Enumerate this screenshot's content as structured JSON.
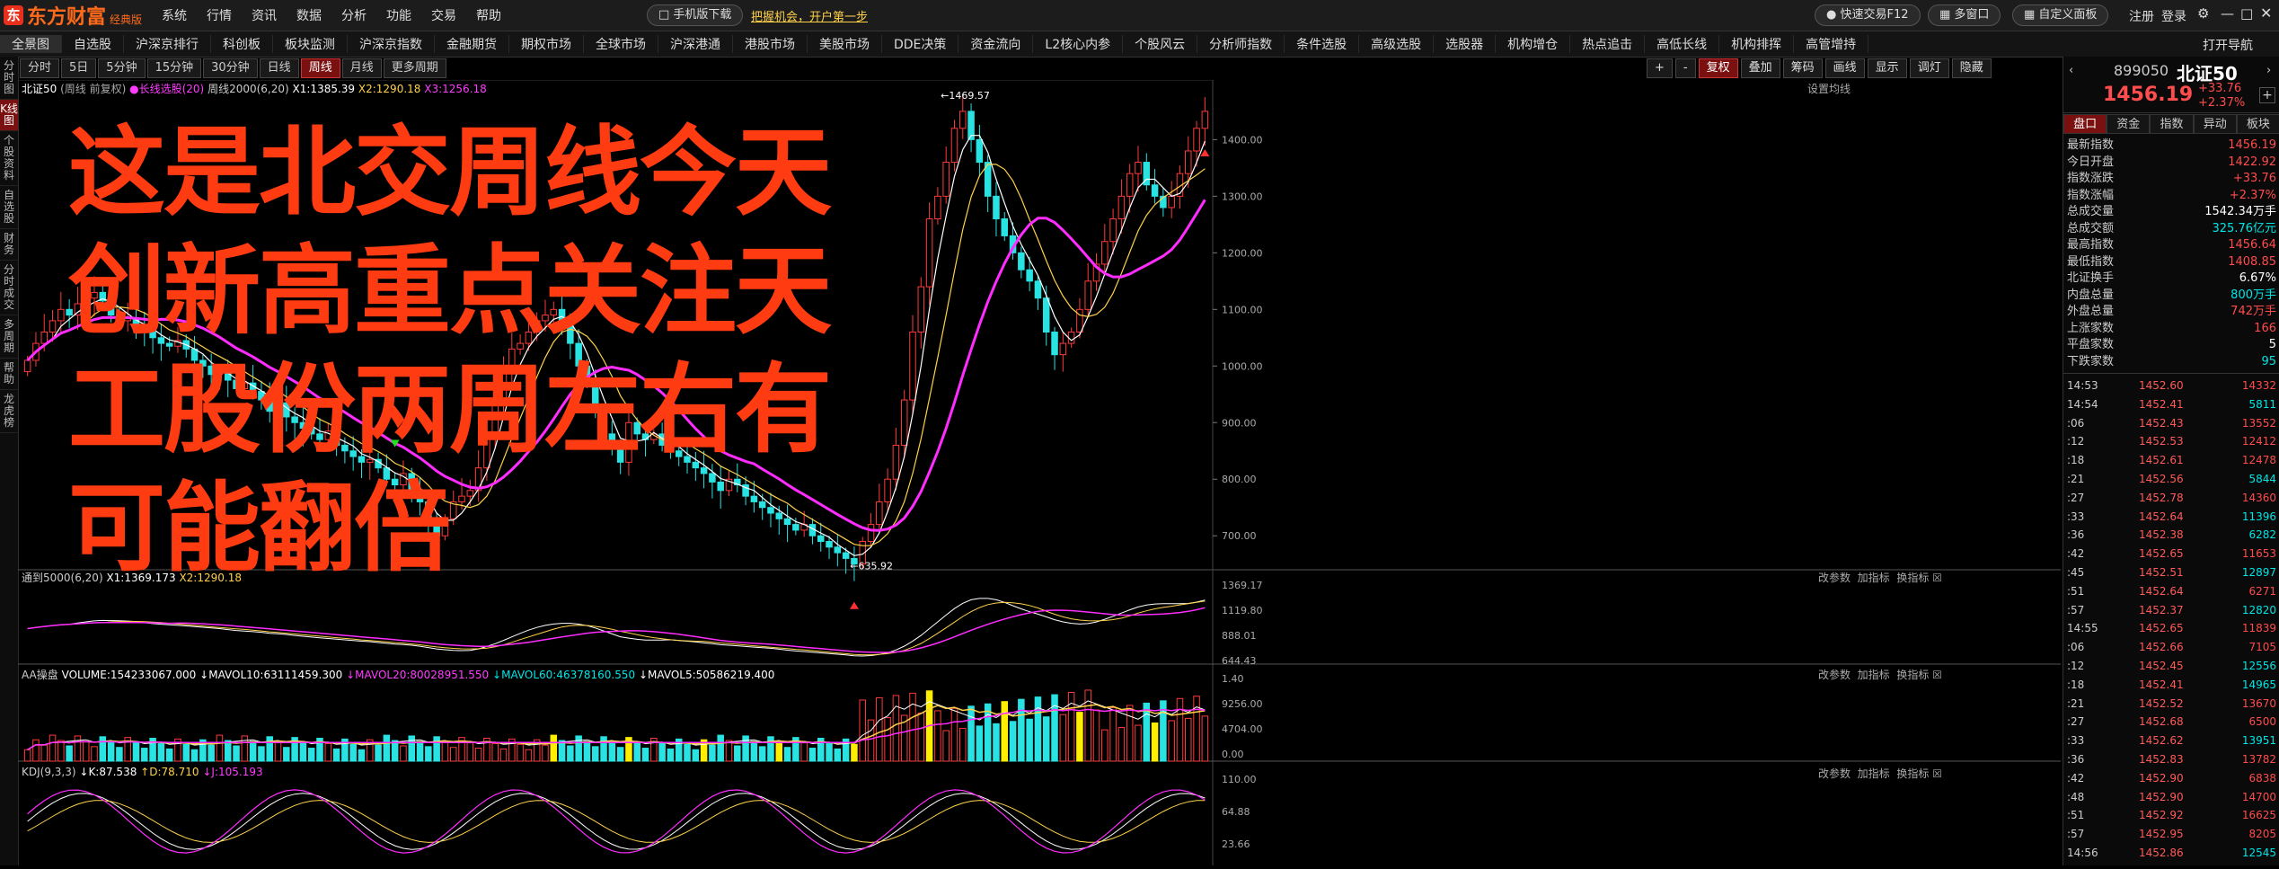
{
  "app": {
    "logo": "东方财富",
    "logo_sub": "经典版",
    "menu": [
      "系统",
      "行情",
      "资讯",
      "数据",
      "分析",
      "功能",
      "交易",
      "帮助"
    ],
    "download": "手机版下载",
    "promo": "把握机会，开户第一步",
    "quick_trade": "快速交易F12",
    "multi_window": "多窗口",
    "custom_panel": "自定义面板",
    "login": "注册",
    "logout": "登录"
  },
  "nav": [
    "全景图",
    "自选股",
    "沪深京排行",
    "科创板",
    "板块监测",
    "沪深京指数",
    "金融期货",
    "期权市场",
    "全球市场",
    "沪深港通",
    "港股市场",
    "美股市场",
    "DDE决策",
    "资金流向",
    "L2核心内参",
    "个股风云",
    "分析师指数",
    "条件选股",
    "高级选股",
    "选股器",
    "机构增仓",
    "热点追击",
    "高低长线",
    "机构排挥",
    "高管增持"
  ],
  "nav_right": "打开导航",
  "periods": [
    "分时",
    "5日",
    "5分钟",
    "15分钟",
    "30分钟",
    "日线",
    "周线",
    "月线",
    "更多周期"
  ],
  "active_period": "周线",
  "tools_right": [
    "+",
    "-",
    "复权",
    "叠加",
    "筹码",
    "画线",
    "显示",
    "调灯",
    "隐藏"
  ],
  "left_strip": [
    "分时图",
    "K线图",
    "个股资料",
    "自选股",
    "财务",
    "分时成交",
    "多周期",
    "帮助",
    "龙虎榜"
  ],
  "chart_header": {
    "name": "北证50",
    "mode": "(周线 前复权)",
    "ma_label": "长线选股(20)",
    "ma2_label": "周线2000(6,20)",
    "x1": "X1:1385.39",
    "x2": "X2:1290.18",
    "x3": "X3:1256.18",
    "setting": "设置均线"
  },
  "overlay_text": [
    "这是北交周线今天",
    "创新高重点关注天",
    "工股份两周左右有",
    "可能翻倍"
  ],
  "chart_data": {
    "type": "candlestick",
    "y_ticks": [
      "1400.00",
      "1300.00",
      "1200.00",
      "1100.00",
      "1000.00",
      "900.00",
      "800.00",
      "700.00"
    ],
    "ylim": [
      640,
      1480
    ],
    "annotations": [
      "1469.57",
      "635.92"
    ],
    "closes": [
      1010,
      1040,
      1060,
      1080,
      1100,
      1090,
      1110,
      1120,
      1130,
      1115,
      1090,
      1080,
      1085,
      1070,
      1060,
      1050,
      1040,
      1035,
      1045,
      1030,
      1010,
      1000,
      985,
      990,
      975,
      960,
      970,
      955,
      940,
      920,
      935,
      910,
      900,
      890,
      880,
      870,
      885,
      860,
      850,
      840,
      830,
      835,
      820,
      800,
      790,
      810,
      780,
      760,
      720,
      700,
      730,
      760,
      770,
      780,
      820,
      880,
      940,
      1000,
      1030,
      1040,
      1060,
      1080,
      1090,
      1100,
      1080,
      1040,
      1000,
      970,
      920,
      880,
      860,
      830,
      900,
      880,
      870,
      880,
      860,
      850,
      840,
      830,
      820,
      810,
      795,
      780,
      800,
      790,
      770,
      760,
      750,
      740,
      730,
      720,
      710,
      720,
      700,
      690,
      680,
      670,
      660,
      650,
      690,
      720,
      760,
      800,
      860,
      940,
      1060,
      1140,
      1260,
      1300,
      1360,
      1420,
      1450,
      1400,
      1360,
      1300,
      1260,
      1230,
      1200,
      1170,
      1150,
      1120,
      1060,
      1020,
      1040,
      1060,
      1100,
      1150,
      1180,
      1220,
      1260,
      1300,
      1340,
      1360,
      1320,
      1300,
      1280,
      1300,
      1340,
      1380,
      1420,
      1450
    ]
  },
  "sub1": {
    "label": "通到5000(6,20)",
    "x1": "X1:1369.173",
    "x2": "X2:1290.18",
    "y_ticks": [
      "1369.17",
      "1119.80",
      "888.01",
      "644.43"
    ],
    "btns": [
      "改参数",
      "加指标",
      "换指标"
    ]
  },
  "sub2": {
    "label": "AA操盘",
    "vol": "VOLUME:154233067.000",
    "mavol10": "MAVOL10:63111459.300",
    "mavol20": "MAVOL20:80028951.550",
    "mavol60": "MAVOL60:46378160.550",
    "mavol5": "MAVOL5:50586219.400",
    "y_ticks": [
      "1.40",
      "9256.00",
      "4704.00",
      "0.00"
    ],
    "btns": [
      "改参数",
      "加指标",
      "换指标"
    ]
  },
  "sub3": {
    "label": "KDJ(9,3,3)",
    "k": "K:87.538",
    "d": "D:78.710",
    "j": "J:105.193",
    "y_ticks": [
      "110.00",
      "64.88",
      "23.66"
    ],
    "btns": [
      "改参数",
      "加指标",
      "换指标"
    ]
  },
  "quote": {
    "code": "899050",
    "name": "北证50",
    "price": "1456.19",
    "change": "+33.76",
    "pct": "+2.37%",
    "tabs": [
      "盘口",
      "资金",
      "指数",
      "异动",
      "板块"
    ],
    "rows": [
      {
        "l": "最新指数",
        "r": "1456.19",
        "c": "red"
      },
      {
        "l": "今日开盘",
        "r": "1422.92",
        "c": "red"
      },
      {
        "l": "指数涨跌",
        "r": "+33.76",
        "c": "red"
      },
      {
        "l": "指数涨幅",
        "r": "+2.37%",
        "c": "red"
      },
      {
        "l": "总成交量",
        "r": "1542.34万手",
        "c": "white"
      },
      {
        "l": "总成交额",
        "r": "325.76亿元",
        "c": "green"
      },
      {
        "l": "最高指数",
        "r": "1456.64",
        "c": "red"
      },
      {
        "l": "最低指数",
        "r": "1408.85",
        "c": "red"
      },
      {
        "l": "北证换手",
        "r": "6.67%",
        "c": "white"
      },
      {
        "l": "内盘总量",
        "r": "800万手",
        "c": "green"
      },
      {
        "l": "外盘总量",
        "r": "742万手",
        "c": "red"
      },
      {
        "l": "上涨家数",
        "r": "166",
        "c": "red"
      },
      {
        "l": "平盘家数",
        "r": "5",
        "c": "white"
      },
      {
        "l": "下跌家数",
        "r": "95",
        "c": "green"
      }
    ],
    "ticks": [
      {
        "t": "14:53",
        "p": "1452.60",
        "v": "14332",
        "c": "red"
      },
      {
        "t": "14:54",
        "p": "1452.41",
        "v": "5811",
        "c": "green"
      },
      {
        "t": ":06",
        "p": "1452.43",
        "v": "13552",
        "c": "red"
      },
      {
        "t": ":12",
        "p": "1452.53",
        "v": "12412",
        "c": "red"
      },
      {
        "t": ":18",
        "p": "1452.61",
        "v": "12478",
        "c": "red"
      },
      {
        "t": ":21",
        "p": "1452.56",
        "v": "5844",
        "c": "green"
      },
      {
        "t": ":27",
        "p": "1452.78",
        "v": "14360",
        "c": "red"
      },
      {
        "t": ":33",
        "p": "1452.64",
        "v": "11396",
        "c": "green"
      },
      {
        "t": ":36",
        "p": "1452.38",
        "v": "6282",
        "c": "green"
      },
      {
        "t": ":42",
        "p": "1452.65",
        "v": "11653",
        "c": "red"
      },
      {
        "t": ":45",
        "p": "1452.51",
        "v": "12897",
        "c": "green"
      },
      {
        "t": ":51",
        "p": "1452.64",
        "v": "6271",
        "c": "red"
      },
      {
        "t": ":57",
        "p": "1452.37",
        "v": "12820",
        "c": "green"
      },
      {
        "t": "14:55",
        "p": "1452.65",
        "v": "11839",
        "c": "red"
      },
      {
        "t": ":06",
        "p": "1452.66",
        "v": "7105",
        "c": "red"
      },
      {
        "t": ":12",
        "p": "1452.45",
        "v": "12556",
        "c": "green"
      },
      {
        "t": ":18",
        "p": "1452.41",
        "v": "14965",
        "c": "green"
      },
      {
        "t": ":21",
        "p": "1452.52",
        "v": "13670",
        "c": "red"
      },
      {
        "t": ":27",
        "p": "1452.68",
        "v": "6500",
        "c": "red"
      },
      {
        "t": ":33",
        "p": "1452.62",
        "v": "13951",
        "c": "green"
      },
      {
        "t": ":36",
        "p": "1452.83",
        "v": "13782",
        "c": "red"
      },
      {
        "t": ":42",
        "p": "1452.90",
        "v": "6838",
        "c": "red"
      },
      {
        "t": ":48",
        "p": "1452.90",
        "v": "14700",
        "c": "red"
      },
      {
        "t": ":51",
        "p": "1452.92",
        "v": "16625",
        "c": "red"
      },
      {
        "t": ":57",
        "p": "1452.95",
        "v": "8205",
        "c": "red"
      },
      {
        "t": "14:56",
        "p": "1452.86",
        "v": "12545",
        "c": "green"
      }
    ]
  }
}
